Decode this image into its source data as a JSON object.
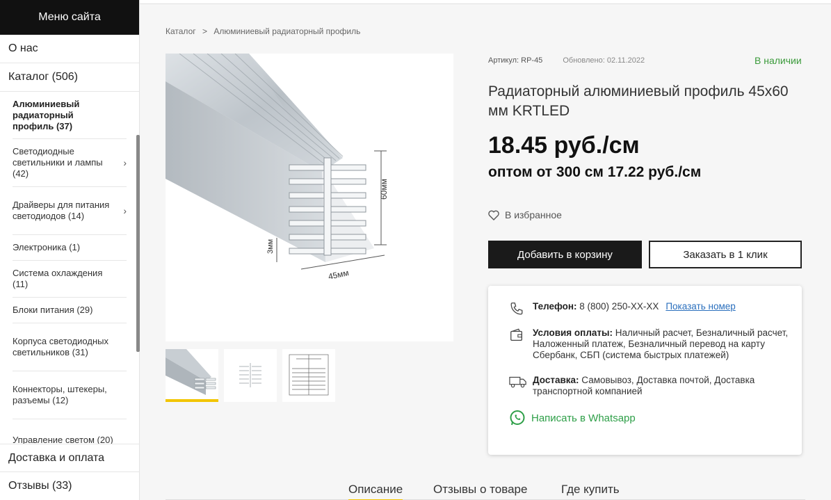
{
  "sidebar": {
    "header": "Меню сайта",
    "top_items": [
      {
        "label": "О нас"
      },
      {
        "label": "Каталог (506)"
      }
    ],
    "sub_items": [
      {
        "label": "Алюминиевый радиаторный профиль (37)",
        "active": true
      },
      {
        "label": "Светодиодные светильники и лампы (42)",
        "has_children": true
      },
      {
        "label": "Драйверы для питания светодиодов (14)",
        "has_children": true
      },
      {
        "label": "Электроника (1)"
      },
      {
        "label": "Система охлаждения (11)"
      },
      {
        "label": "Блоки питания (29)"
      },
      {
        "label": "Корпуса светодиодных светильников (31)"
      },
      {
        "label": "Коннекторы, штекеры, разъемы (12)"
      },
      {
        "label": "Управление светом (20)"
      }
    ],
    "bottom_items": [
      {
        "label": "Доставка и оплата"
      },
      {
        "label": "Отзывы (33)"
      }
    ],
    "chevron": "›"
  },
  "breadcrumb": {
    "items": [
      "Каталог",
      "Алюминиевый радиаторный профиль"
    ],
    "separator": ">"
  },
  "product": {
    "article": "Артикул: RP-45",
    "updated": "Обновлено: 02.11.2022",
    "stock": "В наличии",
    "title": "Радиаторный алюминиевый профиль 45х60 мм KRTLED",
    "price": "18.45 руб./см",
    "wholesale": "оптом от 300 см  17.22 руб./см",
    "favorite": "В избранное",
    "add_to_cart": "Добавить в корзину",
    "one_click": "Заказать в 1 клик",
    "image_labels": {
      "height": "60мм",
      "width": "45мм",
      "thickness": "3мм"
    }
  },
  "info": {
    "phone_label": "Телефон:",
    "phone_value": " 8 (800) 250-XX-XX",
    "phone_show": "Показать номер",
    "payment_label": "Условия оплаты:",
    "payment_value": " Наличный расчет, Безналичный расчет, Наложенный платеж, Безналичный перевод на карту Сбербанк, СБП (система быстрых платежей)",
    "delivery_label": "Доставка:",
    "delivery_value": " Самовывоз, Доставка почтой, Доставка транспортной компанией",
    "whatsapp": "Написать в Whatsapp"
  },
  "tabs": [
    "Описание",
    "Отзывы о товаре",
    "Где купить"
  ],
  "colors": {
    "accent": "#f2c500",
    "stock": "#3a9a3a",
    "whatsapp": "#2e9f48",
    "link": "#2a6fbd"
  }
}
